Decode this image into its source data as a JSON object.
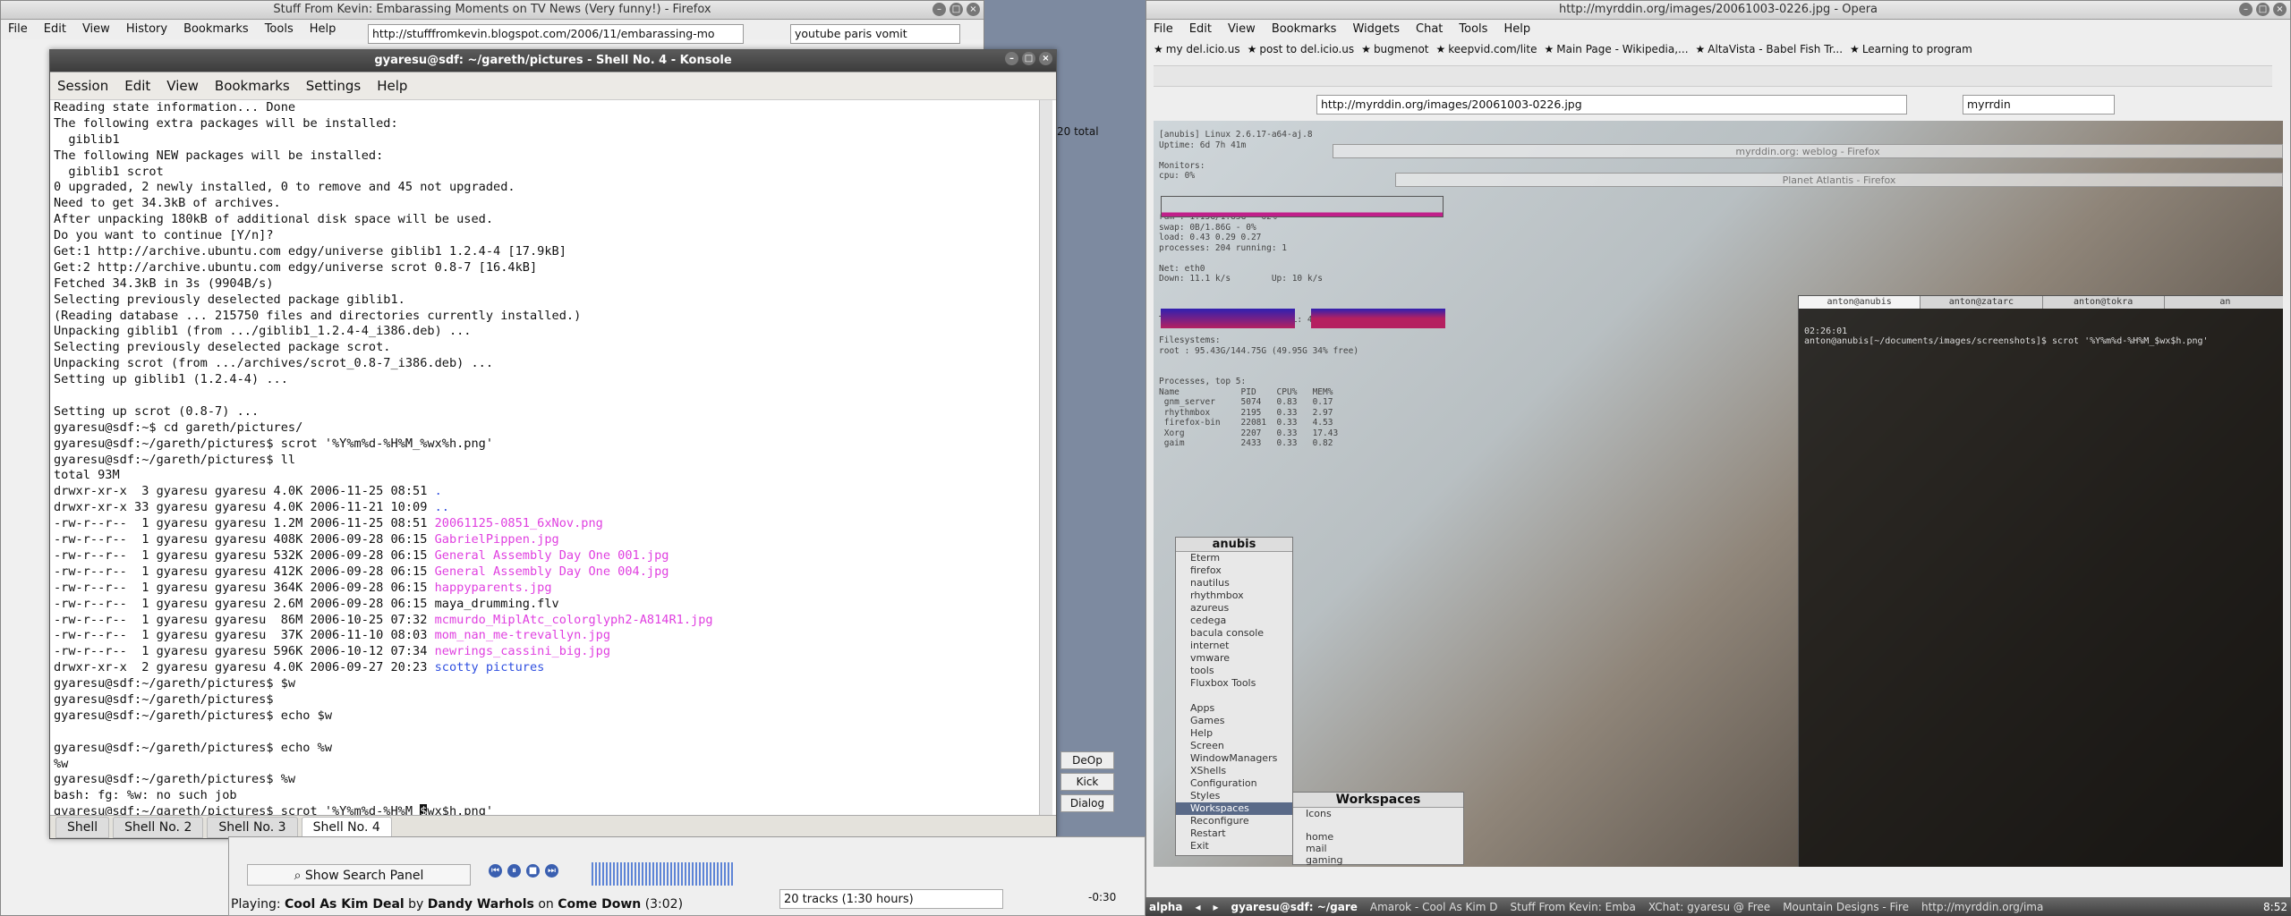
{
  "firefox": {
    "title": "Stuff From Kevin: Embarassing Moments on TV News (Very funny!) - Firefox",
    "menu": [
      "File",
      "Edit",
      "View",
      "History",
      "Bookmarks",
      "Tools",
      "Help"
    ],
    "url": "http://stufffromkevin.blogspot.com/2006/11/embarassing-mo",
    "search": "youtube paris vomit"
  },
  "konsole": {
    "title": "gyaresu@sdf: ~/gareth/pictures - Shell No. 4 - Konsole",
    "menu": [
      "Session",
      "Edit",
      "View",
      "Bookmarks",
      "Settings",
      "Help"
    ],
    "tabs": [
      "Shell",
      "Shell No. 2",
      "Shell No. 3",
      "Shell No. 4"
    ],
    "lines": [
      {
        "t": "Reading state information... Done",
        "c": ""
      },
      {
        "t": "The following extra packages will be installed:",
        "c": ""
      },
      {
        "t": "  giblib1",
        "c": ""
      },
      {
        "t": "The following NEW packages will be installed:",
        "c": ""
      },
      {
        "t": "  giblib1 scrot",
        "c": ""
      },
      {
        "t": "0 upgraded, 2 newly installed, 0 to remove and 45 not upgraded.",
        "c": ""
      },
      {
        "t": "Need to get 34.3kB of archives.",
        "c": ""
      },
      {
        "t": "After unpacking 180kB of additional disk space will be used.",
        "c": ""
      },
      {
        "t": "Do you want to continue [Y/n]?",
        "c": ""
      },
      {
        "t": "Get:1 http://archive.ubuntu.com edgy/universe giblib1 1.2.4-4 [17.9kB]",
        "c": ""
      },
      {
        "t": "Get:2 http://archive.ubuntu.com edgy/universe scrot 0.8-7 [16.4kB]",
        "c": ""
      },
      {
        "t": "Fetched 34.3kB in 3s (9904B/s)",
        "c": ""
      },
      {
        "t": "Selecting previously deselected package giblib1.",
        "c": ""
      },
      {
        "t": "(Reading database ... 215750 files and directories currently installed.)",
        "c": ""
      },
      {
        "t": "Unpacking giblib1 (from .../giblib1_1.2.4-4_i386.deb) ...",
        "c": ""
      },
      {
        "t": "Selecting previously deselected package scrot.",
        "c": ""
      },
      {
        "t": "Unpacking scrot (from .../archives/scrot_0.8-7_i386.deb) ...",
        "c": ""
      },
      {
        "t": "Setting up giblib1 (1.2.4-4) ...",
        "c": ""
      },
      {
        "t": "",
        "c": ""
      },
      {
        "t": "Setting up scrot (0.8-7) ...",
        "c": ""
      },
      {
        "t": "gyaresu@sdf:~$ cd gareth/pictures/",
        "c": ""
      },
      {
        "t": "gyaresu@sdf:~/gareth/pictures$ scrot '%Y%m%d-%H%M_%wx%h.png'",
        "c": ""
      },
      {
        "t": "gyaresu@sdf:~/gareth/pictures$ ll",
        "c": ""
      },
      {
        "t": "total 93M",
        "c": ""
      },
      {
        "t": "drwxr-xr-x  3 gyaresu gyaresu 4.0K 2006-11-25 08:51 ",
        "c": "",
        "f": ".",
        "fc": "c-blue"
      },
      {
        "t": "drwxr-xr-x 33 gyaresu gyaresu 4.0K 2006-11-21 10:09 ",
        "c": "",
        "f": "..",
        "fc": "c-blue"
      },
      {
        "t": "-rw-r--r--  1 gyaresu gyaresu 1.2M 2006-11-25 08:51 ",
        "c": "",
        "f": "20061125-0851_6xNov.png",
        "fc": "c-mag"
      },
      {
        "t": "-rw-r--r--  1 gyaresu gyaresu 408K 2006-09-28 06:15 ",
        "c": "",
        "f": "GabrielPippen.jpg",
        "fc": "c-mag"
      },
      {
        "t": "-rw-r--r--  1 gyaresu gyaresu 532K 2006-09-28 06:15 ",
        "c": "",
        "f": "General Assembly Day One 001.jpg",
        "fc": "c-mag"
      },
      {
        "t": "-rw-r--r--  1 gyaresu gyaresu 412K 2006-09-28 06:15 ",
        "c": "",
        "f": "General Assembly Day One 004.jpg",
        "fc": "c-mag"
      },
      {
        "t": "-rw-r--r--  1 gyaresu gyaresu 364K 2006-09-28 06:15 ",
        "c": "",
        "f": "happyparents.jpg",
        "fc": "c-mag"
      },
      {
        "t": "-rw-r--r--  1 gyaresu gyaresu 2.6M 2006-09-28 06:15 ",
        "c": "",
        "f": "maya_drumming.flv",
        "fc": ""
      },
      {
        "t": "-rw-r--r--  1 gyaresu gyaresu  86M 2006-10-25 07:32 ",
        "c": "",
        "f": "mcmurdo_MiplAtc_colorglyph2-A814R1.jpg",
        "fc": "c-mag"
      },
      {
        "t": "-rw-r--r--  1 gyaresu gyaresu  37K 2006-11-10 08:03 ",
        "c": "",
        "f": "mom_nan_me-trevallyn.jpg",
        "fc": "c-mag"
      },
      {
        "t": "-rw-r--r--  1 gyaresu gyaresu 596K 2006-10-12 07:34 ",
        "c": "",
        "f": "newrings_cassini_big.jpg",
        "fc": "c-mag"
      },
      {
        "t": "drwxr-xr-x  2 gyaresu gyaresu 4.0K 2006-09-27 20:23 ",
        "c": "",
        "f": "scotty pictures",
        "fc": "c-blue"
      },
      {
        "t": "gyaresu@sdf:~/gareth/pictures$ $w",
        "c": ""
      },
      {
        "t": "gyaresu@sdf:~/gareth/pictures$",
        "c": ""
      },
      {
        "t": "gyaresu@sdf:~/gareth/pictures$ echo $w",
        "c": ""
      },
      {
        "t": "",
        "c": ""
      },
      {
        "t": "gyaresu@sdf:~/gareth/pictures$ echo %w",
        "c": ""
      },
      {
        "t": "%w",
        "c": ""
      },
      {
        "t": "gyaresu@sdf:~/gareth/pictures$ %w",
        "c": ""
      },
      {
        "t": "bash: fg: %w: no such job",
        "c": ""
      },
      {
        "t": "gyaresu@sdf:~/gareth/pictures$ scrot '%Y%m%d-%H%M_$wx$h.png'",
        "c": "cursor"
      }
    ]
  },
  "amarok": {
    "search_panel_label": "Show Search Panel",
    "tracks": "20 tracks (1:30 hours)",
    "time": "-0:30",
    "playing_prefix": "Playing:",
    "song": "Cool As Kim Deal",
    "by": "by",
    "artist": "Dandy Warhols",
    "on": "on",
    "album": "Come Down",
    "duration": "(3:02)",
    "playlist_count": "20 total",
    "side_buttons": [
      "DeOp",
      "Kick",
      "Dialog"
    ]
  },
  "opera": {
    "title": "http://myrddin.org/images/20061003-0226.jpg - Opera",
    "menu": [
      "File",
      "Edit",
      "View",
      "Bookmarks",
      "Widgets",
      "Chat",
      "Tools",
      "Help"
    ],
    "bookmarks": [
      "my del.icio.us",
      "post to del.icio.us",
      "bugmenot",
      "keepvid.com/lite",
      "Main Page - Wikipedia,...",
      "AltaVista - Babel Fish Tr...",
      "Learning to program"
    ],
    "url": "http://myrddin.org/images/20061003-0226.jpg",
    "search": "myrrdin",
    "overlay_window_1": "myrddin.org: weblog - Firefox",
    "overlay_window_2": "Planet Atlantis - Firefox",
    "conky": [
      "[anubis] Linux 2.6.17-a64-aj.8",
      "Uptime: 6d 7h 41m",
      "",
      "Monitors:",
      "cpu: 0%",
      "",
      "",
      "",
      "ram : 1.15G/1.83G - 62%",
      "swap: 0B/1.86G - 0%",
      "load: 0.43 0.29 0.27",
      "processes: 204 running: 1",
      "",
      "Net: eth0",
      "Down: 11.1 k/s        Up: 10 k/s",
      "",
      "",
      "",
      "TOTAL: 9.71G          TOTAL: 4.63G",
      "",
      "Filesystems:",
      "root : 95.43G/144.75G (49.95G 34% free)",
      "",
      "",
      "Processes, top 5:",
      "Name            PID    CPU%   MEM%",
      " gnm_server     5074   0.83   0.17",
      " rhythmbox      2195   0.33   2.97",
      " firefox-bin    22081  0.33   4.53",
      " Xorg           2207   0.33   17.43",
      " gaim           2433   0.33   0.82"
    ],
    "flux_menu_title": "anubis",
    "flux_menu": [
      "Eterm",
      "firefox",
      "nautilus",
      "rhythmbox",
      "azureus",
      "cedega",
      "bacula console",
      "internet",
      "vmware",
      "tools",
      "Fluxbox Tools",
      "",
      "Apps",
      "Games",
      "Help",
      "Screen",
      "WindowManagers",
      "XShells",
      "Configuration",
      "Styles",
      "Workspaces",
      "Reconfigure",
      "Restart",
      "Exit"
    ],
    "workspaces_title": "Workspaces",
    "workspaces": [
      "Icons",
      "",
      "home",
      "mail",
      "gaming"
    ],
    "mini_term_tabs": [
      "anton@anubis",
      "anton@zatarc",
      "anton@tokra",
      "an"
    ],
    "mini_term_lines": [
      "02:26:01",
      "anton@anubis[~/documents/images/screenshots]$ scrot '%Y%m%d-%H%M_$wx$h.png'"
    ]
  },
  "taskbar": {
    "workspace": "alpha",
    "tasks": [
      "gyaresu@sdf: ~/gare",
      "Amarok - Cool As Kim D",
      "Stuff From Kevin: Emba",
      "XChat: gyaresu @ Free",
      "Mountain Designs - Fire",
      "http://myrddin.org/ima"
    ],
    "clock": "8:52"
  },
  "colors": {
    "term_file_image": "#e040e0",
    "term_dir": "#3050e0",
    "taskbar_bg": "#4a4a4a"
  }
}
